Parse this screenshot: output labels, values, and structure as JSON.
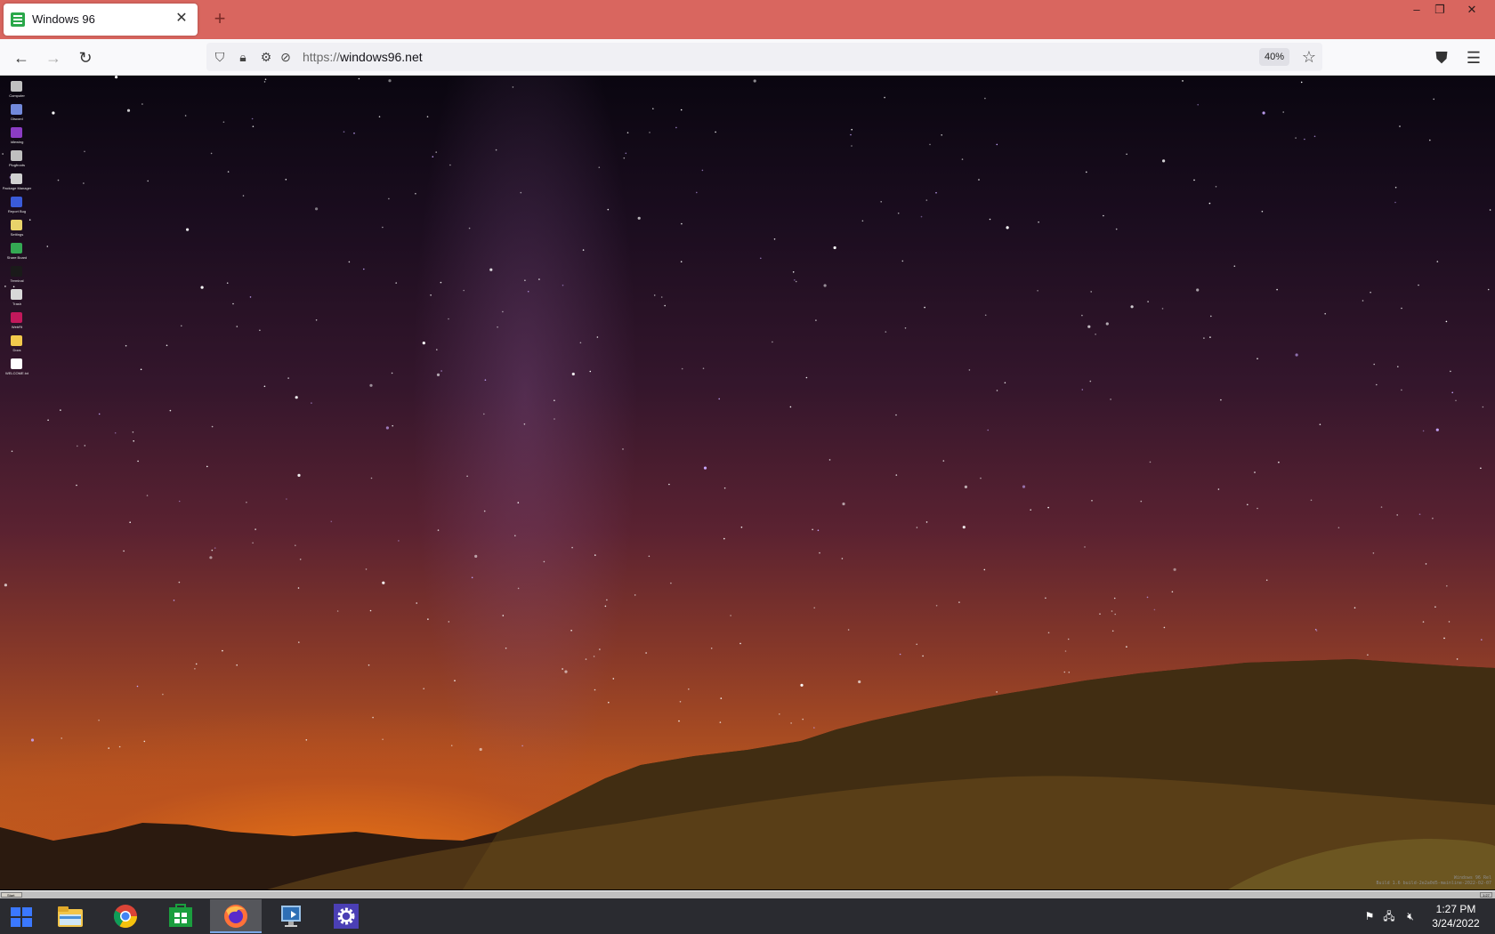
{
  "browser": {
    "tab": {
      "title": "Windows 96"
    },
    "url": {
      "scheme": "https://",
      "host": "windows96.net"
    },
    "zoom_level": "40%"
  },
  "desktop": {
    "icons": [
      {
        "label": "Computer",
        "color": "#c0c0c0"
      },
      {
        "label": "Discord",
        "color": "#7289da"
      },
      {
        "label": "Idlewing",
        "color": "#8b3cc4"
      },
      {
        "label": "Plugfroots",
        "color": "#bfbfbf"
      },
      {
        "label": "Package Manager",
        "color": "#d0d0d0"
      },
      {
        "label": "Report Bug",
        "color": "#3a5bd9"
      },
      {
        "label": "Settings",
        "color": "#e8d36a"
      },
      {
        "label": "Share Board",
        "color": "#34a853"
      },
      {
        "label": "Terminal",
        "color": "#1a1a1a"
      },
      {
        "label": "Trash",
        "color": "#d8d8d8"
      },
      {
        "label": "WebRt",
        "color": "#c2185b"
      },
      {
        "label": "Docs",
        "color": "#f2c94c"
      },
      {
        "label": "WELCOME.txt",
        "color": "#ffffff"
      }
    ],
    "build_text": "Windows 96 Rel\nBuild 1.6 build-2e2a0d5-mainline-2022-02-07"
  },
  "win96_taskbar": {
    "start_label": "Start",
    "clock": "1:27"
  },
  "taskbar": {
    "apps": [
      {
        "name": "File Explorer",
        "icon": "file-explorer-icon"
      },
      {
        "name": "Google Chrome",
        "icon": "chrome-icon"
      },
      {
        "name": "Microsoft Store",
        "icon": "store-icon"
      },
      {
        "name": "Firefox",
        "icon": "firefox-icon",
        "active": true
      },
      {
        "name": "Remote Desktop",
        "icon": "remote-desktop-icon"
      },
      {
        "name": "Settings",
        "icon": "settings-icon"
      }
    ],
    "time": "1:27 PM",
    "date": "3/24/2022"
  },
  "colors": {
    "tabstrip": "#d9665f",
    "taskbar": "#2a2b30",
    "start_logo": "#3b78ff"
  }
}
